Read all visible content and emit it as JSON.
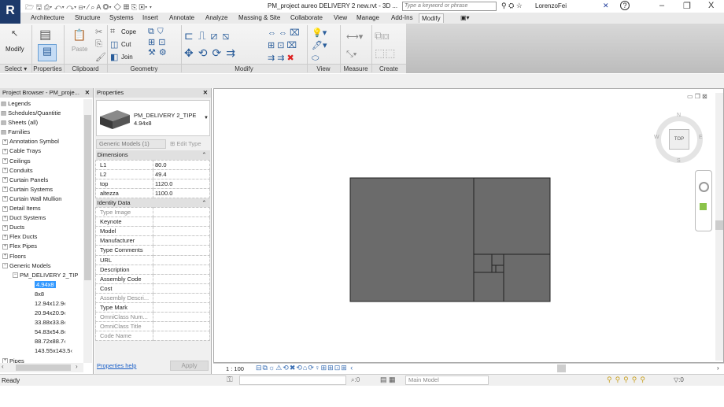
{
  "app": {
    "logo": "R",
    "document_title": "PM_project aureo DELIVERY 2 new.rvt - 3D ...",
    "search_placeholder": "Type a keyword or phrase",
    "user": "LorenzoFei",
    "help": "?",
    "minimize": "–",
    "restore": "❐",
    "close": "X"
  },
  "ribbon_tabs": [
    "Architecture",
    "Structure",
    "Systems",
    "Insert",
    "Annotate",
    "Analyze",
    "Massing & Site",
    "Collaborate",
    "View",
    "Manage",
    "Add-Ins",
    "Modify",
    "▣▾"
  ],
  "active_tab": "Modify",
  "ribbon": {
    "modify_label": "Modify",
    "paste_label": "Paste",
    "cope_label": "Cope",
    "cut_label": "Cut",
    "join_label": "Join",
    "panels": [
      "Select ▾",
      "Properties",
      "Clipboard",
      "Geometry",
      "Modify",
      "View",
      "Measure",
      "Create"
    ]
  },
  "project_browser": {
    "title": "Project Browser - PM_proje...",
    "close": "✕",
    "items": [
      {
        "label": "Legends",
        "level": 0,
        "icon": "legend-icon"
      },
      {
        "label": "Schedules/Quantitie",
        "level": 0,
        "icon": "schedule-icon"
      },
      {
        "label": "Sheets (all)",
        "level": 0,
        "icon": "sheet-icon"
      },
      {
        "label": "Families",
        "level": 0,
        "icon": "family-icon"
      },
      {
        "label": "Annotation Symbol",
        "level": 1,
        "exp": "+"
      },
      {
        "label": "Cable Trays",
        "level": 1,
        "exp": "+"
      },
      {
        "label": "Ceilings",
        "level": 1,
        "exp": "+"
      },
      {
        "label": "Conduits",
        "level": 1,
        "exp": "+"
      },
      {
        "label": "Curtain Panels",
        "level": 1,
        "exp": "+"
      },
      {
        "label": "Curtain Systems",
        "level": 1,
        "exp": "+"
      },
      {
        "label": "Curtain Wall Mullion",
        "level": 1,
        "exp": "+"
      },
      {
        "label": "Detail Items",
        "level": 1,
        "exp": "+"
      },
      {
        "label": "Duct Systems",
        "level": 1,
        "exp": "+"
      },
      {
        "label": "Ducts",
        "level": 1,
        "exp": "+"
      },
      {
        "label": "Flex Ducts",
        "level": 1,
        "exp": "+"
      },
      {
        "label": "Flex Pipes",
        "level": 1,
        "exp": "+"
      },
      {
        "label": "Floors",
        "level": 1,
        "exp": "+"
      },
      {
        "label": "Generic Models",
        "level": 1,
        "exp": "−"
      },
      {
        "label": "PM_DELIVERY 2_TIP",
        "level": 2,
        "exp": "−"
      },
      {
        "label": "4.94x8",
        "level": 3,
        "selected": true
      },
      {
        "label": "8x8",
        "level": 3
      },
      {
        "label": "12.94x12.9‹",
        "level": 3
      },
      {
        "label": "20.94x20.9‹",
        "level": 3
      },
      {
        "label": "33.88x33.8‹",
        "level": 3
      },
      {
        "label": "54.83x54.8‹",
        "level": 3
      },
      {
        "label": "88.72x88.7‹",
        "level": 3
      },
      {
        "label": "143.55x143.5‹",
        "level": 3
      },
      {
        "label": "Pipes",
        "level": 1,
        "exp": "+"
      }
    ]
  },
  "properties": {
    "title": "Properties",
    "close": "✕",
    "type_name": "PM_DELIVERY 2_TIPE",
    "type_sub": "4.94x8",
    "filter": "Generic Models (1)",
    "edit_type": "Edit Type",
    "groups": [
      {
        "name": "Dimensions",
        "rows": [
          {
            "k": "L1",
            "v": "80.0"
          },
          {
            "k": "L2",
            "v": "49.4"
          },
          {
            "k": "top",
            "v": "1120.0"
          },
          {
            "k": "altezza",
            "v": "1100.0"
          }
        ]
      },
      {
        "name": "Identity Data",
        "rows": [
          {
            "k": "Type Image",
            "v": "",
            "dim": true
          },
          {
            "k": "Keynote",
            "v": ""
          },
          {
            "k": "Model",
            "v": ""
          },
          {
            "k": "Manufacturer",
            "v": ""
          },
          {
            "k": "Type Comments",
            "v": ""
          },
          {
            "k": "URL",
            "v": ""
          },
          {
            "k": "Description",
            "v": ""
          },
          {
            "k": "Assembly Code",
            "v": ""
          },
          {
            "k": "Cost",
            "v": ""
          },
          {
            "k": "Assembly Descri...",
            "v": "",
            "dim": true
          },
          {
            "k": "Type Mark",
            "v": ""
          },
          {
            "k": "OmniClass Num...",
            "v": "",
            "dim": true
          },
          {
            "k": "OmniClass Title",
            "v": "",
            "dim": true
          },
          {
            "k": "Code Name",
            "v": "",
            "dim": true
          }
        ]
      }
    ],
    "help_link": "Properties help",
    "apply": "Apply"
  },
  "viewcube": {
    "face": "TOP",
    "n": "N",
    "s": "S",
    "e": "E",
    "w": "W"
  },
  "view": {
    "scale": "1 : 100",
    "fill_color": "#6b6b6b"
  },
  "status": {
    "text": "Ready",
    "sel_count": ":0",
    "workset": "Main Model",
    "filter_count": ":0"
  }
}
